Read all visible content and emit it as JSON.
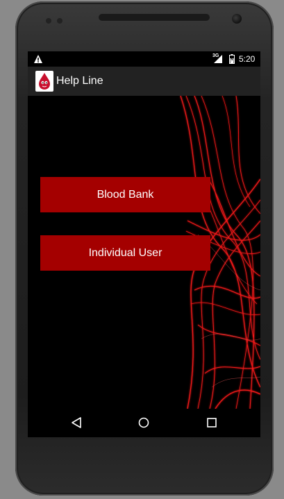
{
  "status_bar": {
    "warning_icon": "warning-icon",
    "network": "3G",
    "signal_icon": "signal-icon",
    "battery_icon": "battery-icon",
    "time": "5:20"
  },
  "app_bar": {
    "icon": "blood-drop-icon",
    "title": "Help Line"
  },
  "main": {
    "background": "red-light-streaks",
    "buttons": [
      {
        "label": "Blood Bank"
      },
      {
        "label": "Individual User"
      }
    ]
  },
  "nav_bar": {
    "back_icon": "back-triangle-icon",
    "home_icon": "home-circle-icon",
    "recents_icon": "recents-square-icon"
  },
  "colors": {
    "button_bg": "#a40000",
    "app_bar_bg": "#222222",
    "accent_red": "#ff1a1a"
  }
}
